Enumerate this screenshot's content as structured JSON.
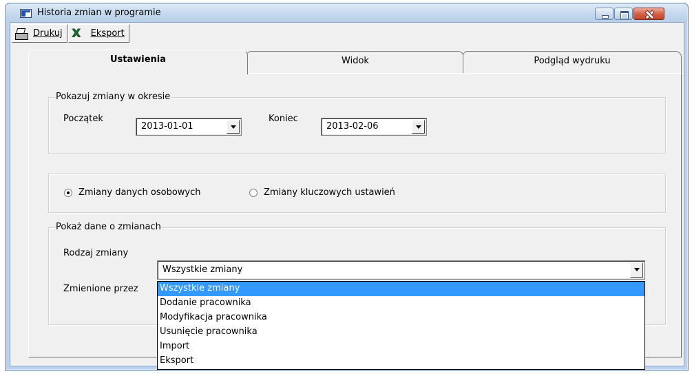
{
  "window": {
    "title": "Historia zmian w programie"
  },
  "toolbar": {
    "print_label": "Drukuj",
    "export_label": "Eksport"
  },
  "tabs": [
    {
      "label": "Ustawienia",
      "active": true
    },
    {
      "label": "Widok",
      "active": false
    },
    {
      "label": "Podgląd wydruku",
      "active": false
    }
  ],
  "period": {
    "title": "Pokazuj zmiany w okresie",
    "start_label": "Początek",
    "start_value": "2013-01-01",
    "end_label": "Koniec",
    "end_value": "2013-02-06"
  },
  "change_scope": {
    "options": [
      {
        "label": "Zmiany danych osobowych",
        "checked": true
      },
      {
        "label": "Zmiany kluczowych ustawień",
        "checked": false
      }
    ]
  },
  "details": {
    "title": "Pokaż dane o zmianach",
    "type_label": "Rodzaj zmiany",
    "type_value": "Wszystkie zmiany",
    "changed_by_label": "Zmienione przez",
    "type_options": [
      "Wszystkie zmiany",
      "Dodanie pracownika",
      "Modyfikacja pracownika",
      "Usunięcie pracownika",
      "Import",
      "Eksport"
    ],
    "selected_option": "Wszystkie zmiany"
  },
  "colors": {
    "selection": "#3399ff",
    "close_button": "#c3452b",
    "title_bar": "#c4d8ee"
  }
}
